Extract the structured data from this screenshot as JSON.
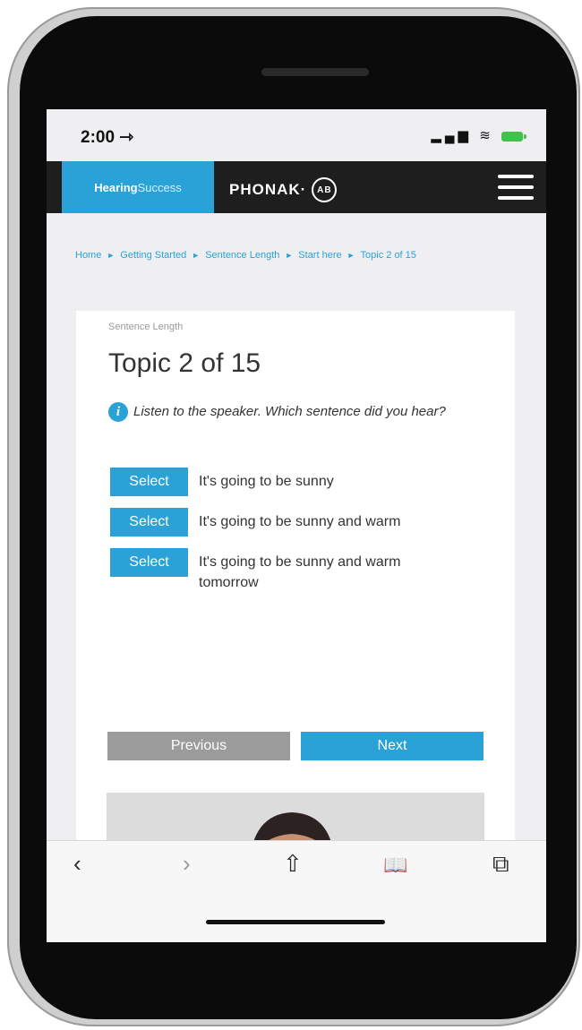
{
  "status_bar": {
    "time": "2:00 ⇾",
    "icons": "▂▄▆ ≋"
  },
  "navbar": {
    "brand_bold": "Hearing",
    "brand_light": "Success",
    "partner": "PHONAK·",
    "partner_badge": "AB"
  },
  "breadcrumb": {
    "items": [
      "Home",
      "Getting Started",
      "Sentence Length",
      "Start here",
      "Topic 2 of 15"
    ],
    "separator": "►"
  },
  "card": {
    "section_label": "Sentence Length",
    "title": "Topic 2 of 15",
    "prompt": "Listen to the speaker. Which sentence did you hear?",
    "info_icon": "i",
    "options": [
      {
        "button": "Select",
        "text": "It's going to be sunny"
      },
      {
        "button": "Select",
        "text": "It's going to be sunny and warm"
      },
      {
        "button": "Select",
        "text": "It's going to be sunny and warm tomorrow"
      }
    ],
    "previous_label": "Previous",
    "next_label": "Next"
  },
  "toolbar": {
    "back": "‹",
    "forward": "›",
    "share": "⇧",
    "bookmarks": "📖",
    "tabs": "⧉"
  },
  "colors": {
    "accent": "#2aa2d8",
    "navbar": "#1e1e1e",
    "previous": "#9b9b9b"
  }
}
